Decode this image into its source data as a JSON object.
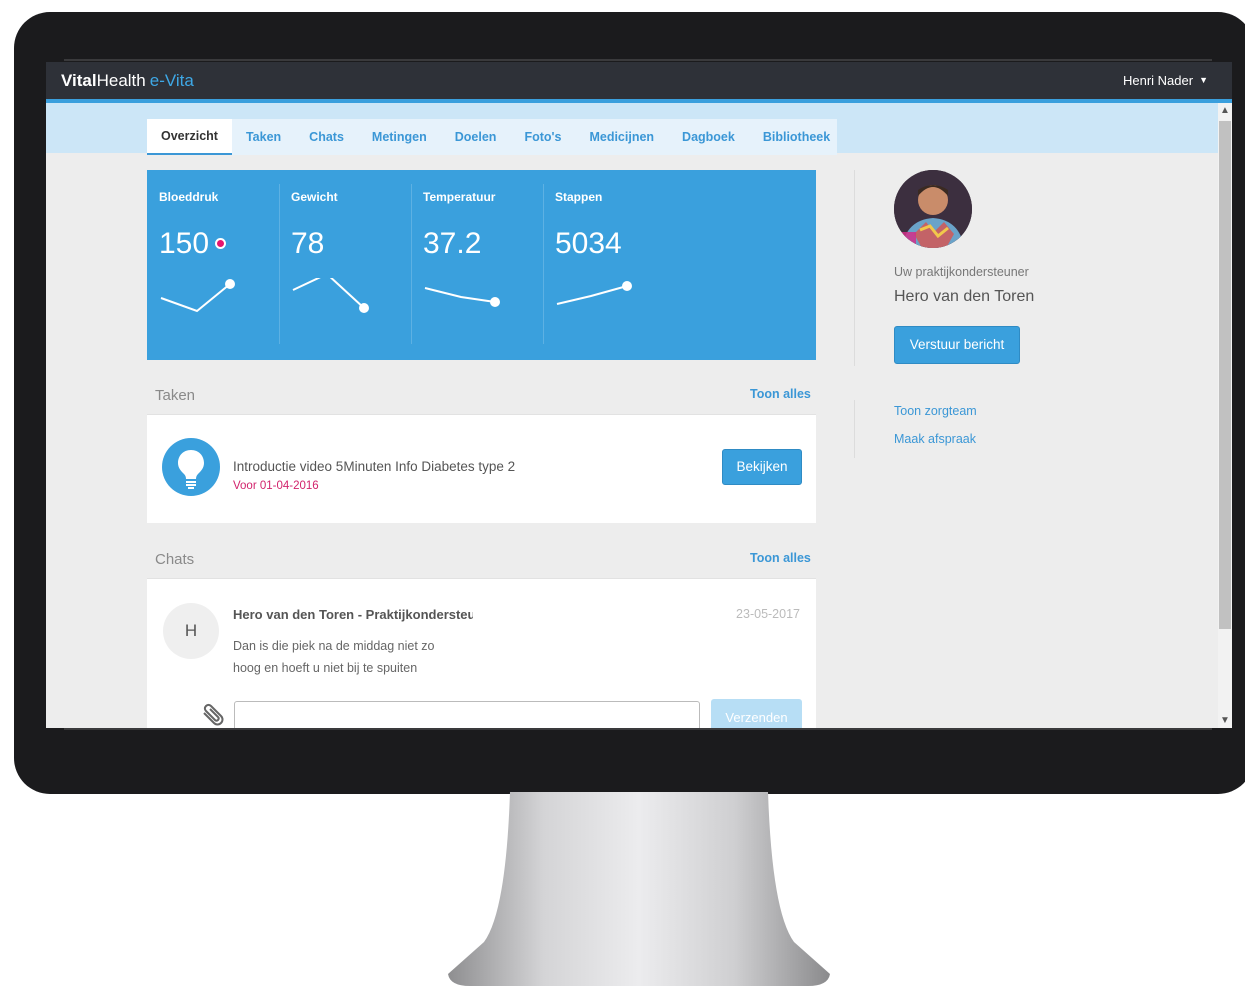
{
  "app": {
    "brand_bold": "Vital",
    "brand_regular": "Health",
    "brand_accent": "e-Vita",
    "user_name": "Henri Nader"
  },
  "tabs": [
    {
      "label": "Overzicht",
      "active": true
    },
    {
      "label": "Taken"
    },
    {
      "label": "Chats"
    },
    {
      "label": "Metingen"
    },
    {
      "label": "Doelen"
    },
    {
      "label": "Foto's"
    },
    {
      "label": "Medicijnen"
    },
    {
      "label": "Dagboek"
    },
    {
      "label": "Bibliotheek"
    }
  ],
  "metrics": [
    {
      "label": "Bloeddruk",
      "value": "150",
      "alert": true
    },
    {
      "label": "Gewicht",
      "value": "78"
    },
    {
      "label": "Temperatuur",
      "value": "37.2"
    },
    {
      "label": "Stappen",
      "value": "5034"
    }
  ],
  "tasks": {
    "title": "Taken",
    "show_all": "Toon alles",
    "item": {
      "title": "Introductie video 5Minuten Info Diabetes type 2",
      "due": "Voor 01-04-2016",
      "button": "Bekijken",
      "icon": "lightbulb-icon"
    }
  },
  "chats": {
    "title": "Chats",
    "show_all": "Toon alles",
    "item": {
      "avatar_initial": "H",
      "sender": "Hero van den Toren - Praktijkondersteuner",
      "date": "23-05-2017",
      "message": "Dan is die piek na de middag niet zo hoog en hoeft u niet bij te spuiten"
    },
    "input_value": "",
    "send_button": "Verzenden",
    "attach_icon": "paperclip-icon"
  },
  "sidebar": {
    "role_label": "Uw praktijkondersteuner",
    "name": "Hero van den Toren",
    "message_button": "Verstuur bericht",
    "link_care_team": "Toon zorgteam",
    "link_appointment": "Maak afspraak"
  },
  "colors": {
    "accent": "#3aa0dd",
    "header": "#2e3138",
    "alert": "#e5156e",
    "tab_strip": "#cce6f7"
  }
}
